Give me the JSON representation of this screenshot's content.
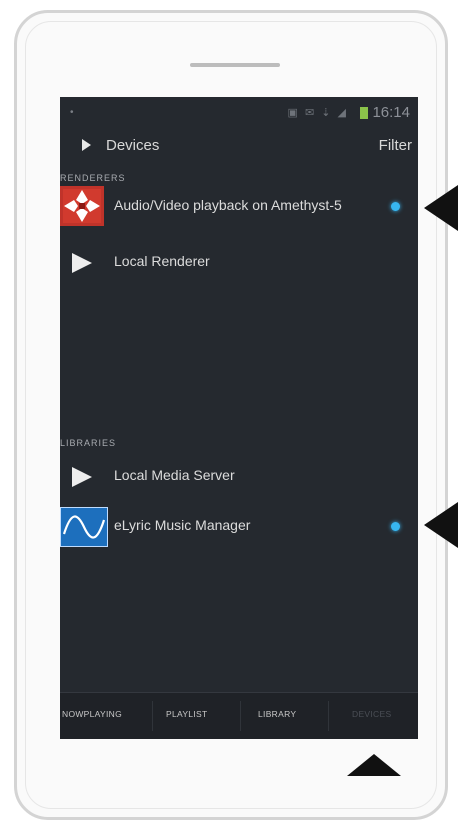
{
  "status_bar": {
    "left_text": "•",
    "icons_text": "▣ ✉ ⇣ ◢",
    "time": "16:14"
  },
  "header": {
    "title": "Devices",
    "filter_label": "Filter"
  },
  "renderers": {
    "section_label": "RENDERERS",
    "items": [
      {
        "label": "Audio/Video playback on Amethyst-5",
        "icon": "amethyst-logo-icon",
        "active": true
      },
      {
        "label": "Local Renderer",
        "icon": "play-icon",
        "active": false
      }
    ]
  },
  "libraries": {
    "section_label": "LIBRARIES",
    "items": [
      {
        "label": "Local Media Server",
        "icon": "play-icon",
        "active": false
      },
      {
        "label": "eLyric Music Manager",
        "icon": "elyric-logo-icon",
        "active": true
      }
    ]
  },
  "tabs": [
    {
      "label": "NOWPLAYING",
      "dim": false
    },
    {
      "label": "PLAYLIST",
      "dim": false
    },
    {
      "label": "LIBRARY",
      "dim": false
    },
    {
      "label": "DEVICES",
      "dim": true
    }
  ],
  "colors": {
    "screen_bg": "#25292f",
    "active_dot": "#37b6f1",
    "callout_arrow": "#111111"
  }
}
